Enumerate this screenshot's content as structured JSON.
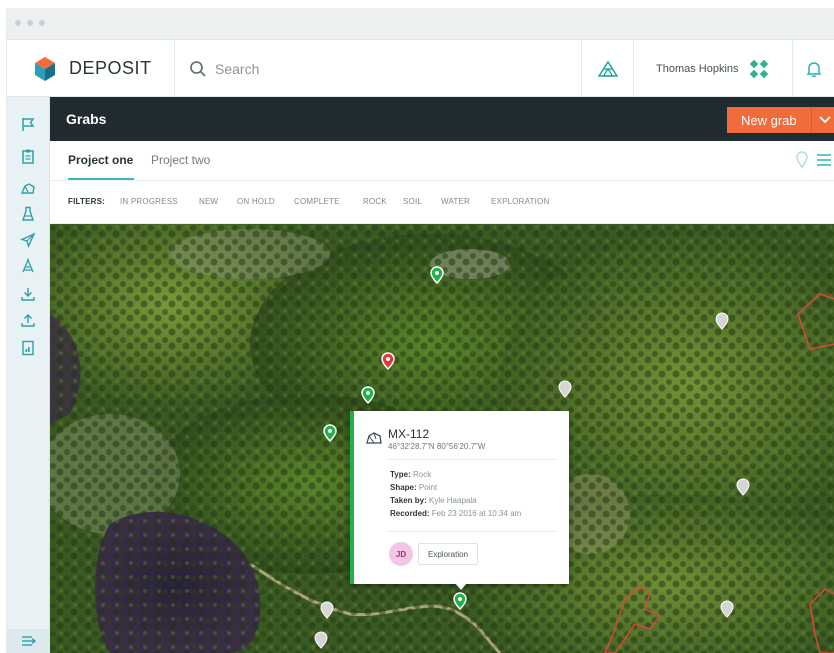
{
  "app": {
    "brand": "DEPOSIT"
  },
  "search": {
    "placeholder": "Search"
  },
  "user": {
    "name": "Thomas Hopkins"
  },
  "header": {
    "title": "Grabs",
    "new_grab_label": "New grab"
  },
  "tabs": [
    {
      "label": "Project one",
      "active": true
    },
    {
      "label": "Project two",
      "active": false
    }
  ],
  "filters": {
    "label": "FILTERS:",
    "items": [
      "IN PROGRESS",
      "NEW",
      "ON HOLD",
      "COMPLETE",
      "ROCK",
      "SOIL",
      "WATER",
      "EXPLORATION"
    ]
  },
  "sidebar": {
    "items": [
      "flag-icon",
      "clipboard-icon",
      "hand-rock-icon",
      "flask-icon",
      "send-icon",
      "drill-icon",
      "download-icon",
      "upload-icon",
      "report-icon"
    ],
    "collapse_icon": "expand-icon"
  },
  "popup": {
    "id": "MX-112",
    "coords": "46°32'28.7\"N  80°56'20.7\"W",
    "type_label": "Type:",
    "type_value": "Rock",
    "shape_label": "Shape:",
    "shape_value": "Point",
    "taken_by_label": "Taken by:",
    "taken_by_value": "Kyle Haapala",
    "recorded_label": "Recorded:",
    "recorded_value": "Feb 23 2016 at 10:34 am",
    "avatar_initials": "JD",
    "tag": "Exploration"
  },
  "colors": {
    "accent_orange": "#f26b3a",
    "header_dark": "#212c30",
    "teal": "#38b7c2",
    "marker_green": "#22b04a",
    "marker_red": "#e23b3b",
    "marker_gray": "#c8c8c8",
    "boundary_red": "#d74a3a"
  }
}
